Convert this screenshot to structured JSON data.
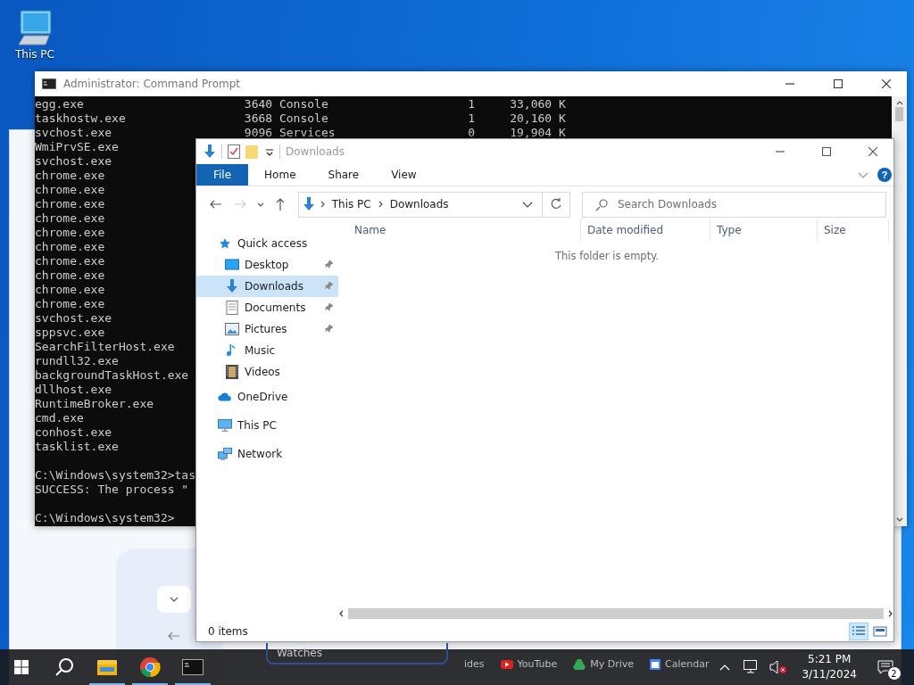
{
  "desktop_icons": [
    {
      "label": "This PC"
    }
  ],
  "background_window": {
    "button": "Watches",
    "bookmarks": [
      {
        "label": "ides",
        "kind": "text"
      },
      {
        "label": "YouTube",
        "kind": "youtube"
      },
      {
        "label": "My Drive",
        "kind": "drive"
      },
      {
        "label": "Calendar",
        "kind": "calendar"
      }
    ]
  },
  "cmd": {
    "title": "Administrator: Command Prompt",
    "blocks": [
      {
        "lines": [
          {
            "text": "egg.exe                       3640 Console                    1     33,060 K"
          },
          {
            "text": "taskhostw.exe                 3668 Console                    1     20,160 K"
          },
          {
            "text": "svchost.exe                   9096 Services                   0     19,904 K"
          },
          {
            "text": "WmiPrvSE.exe"
          },
          {
            "text": "svchost.exe"
          },
          {
            "text": "chrome.exe"
          },
          {
            "text": "chrome.exe"
          },
          {
            "text": "chrome.exe"
          },
          {
            "text": "chrome.exe"
          },
          {
            "text": "chrome.exe"
          },
          {
            "text": "chrome.exe"
          },
          {
            "text": "chrome.exe"
          },
          {
            "text": "chrome.exe"
          },
          {
            "text": "chrome.exe"
          },
          {
            "text": "chrome.exe"
          },
          {
            "text": "svchost.exe"
          },
          {
            "text": "sppsvc.exe"
          },
          {
            "text": "SearchFilterHost.exe"
          },
          {
            "text": "rundll32.exe"
          },
          {
            "text": "backgroundTaskHost.exe"
          },
          {
            "text": "dllhost.exe"
          },
          {
            "text": "RuntimeBroker.exe"
          },
          {
            "text": "cmd.exe"
          },
          {
            "text": "conhost.exe"
          },
          {
            "text": "tasklist.exe"
          }
        ]
      },
      {
        "lines": [
          {
            "text": "C:\\Windows\\system32>tas"
          },
          {
            "text": "SUCCESS: The process \""
          }
        ]
      },
      {
        "lines": [
          {
            "text": "C:\\Windows\\system32>"
          }
        ]
      }
    ]
  },
  "explorer": {
    "title": "Downloads",
    "ribbon_tabs": [
      {
        "label": "File",
        "selected": true
      },
      {
        "label": "Home",
        "selected": false
      },
      {
        "label": "Share",
        "selected": false
      },
      {
        "label": "View",
        "selected": false
      }
    ],
    "address": {
      "path": [
        "This PC",
        "Downloads"
      ]
    },
    "search": {
      "placeholder": "Search Downloads"
    },
    "nav": [
      {
        "label": "Quick access",
        "kind": "star",
        "selected": false,
        "children": [
          {
            "label": "Desktop",
            "kind": "desktop",
            "pinned": true,
            "selected": false
          },
          {
            "label": "Downloads",
            "kind": "download",
            "pinned": true,
            "selected": true
          },
          {
            "label": "Documents",
            "kind": "document",
            "pinned": true,
            "selected": false
          },
          {
            "label": "Pictures",
            "kind": "picture",
            "pinned": true,
            "selected": false
          },
          {
            "label": "Music",
            "kind": "music",
            "pinned": false,
            "selected": false
          },
          {
            "label": "Videos",
            "kind": "video",
            "pinned": false,
            "selected": false
          }
        ]
      },
      {
        "label": "OneDrive",
        "kind": "cloud",
        "selected": false
      },
      {
        "label": "This PC",
        "kind": "monitor",
        "selected": false
      },
      {
        "label": "Network",
        "kind": "network",
        "selected": false
      }
    ],
    "help_button": "?",
    "columns": [
      "Name",
      "Date modified",
      "Type",
      "Size"
    ],
    "empty_message": "This folder is empty.",
    "status": "0 items",
    "views": [
      {
        "kind": "details",
        "selected": true
      },
      {
        "kind": "large-icons",
        "selected": false
      }
    ]
  },
  "taskbar": {
    "apps": [
      {
        "kind": "explorer",
        "running": true
      },
      {
        "kind": "chrome",
        "running": true
      },
      {
        "kind": "cmd",
        "running": true
      }
    ],
    "time": "5:21 PM",
    "date": "3/11/2024",
    "notification_count": "2"
  }
}
